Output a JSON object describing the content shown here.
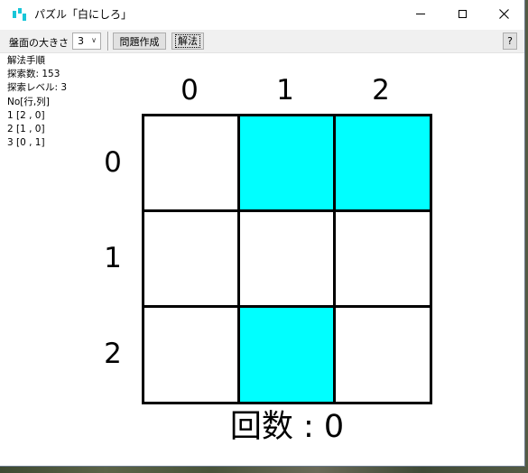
{
  "window": {
    "title": "パズル「白にしろ」"
  },
  "toolbar": {
    "size_label": "盤面の大きさ",
    "size_value": "3",
    "make_button": "問題作成",
    "solve_button": "解法",
    "help_button": "?"
  },
  "solution_log": {
    "heading": "解法手順",
    "search_count": "探索数: 153",
    "search_level": "探索レベル: 3",
    "header": "No[行,列]",
    "steps": [
      "1 [2 , 0]",
      "2 [1 , 0]",
      "3 [0 , 1]"
    ]
  },
  "board": {
    "column_labels": [
      "0",
      "1",
      "2"
    ],
    "row_labels": [
      "0",
      "1",
      "2"
    ],
    "cells": [
      [
        false,
        true,
        true
      ],
      [
        false,
        false,
        false
      ],
      [
        false,
        true,
        false
      ]
    ],
    "on_color": "#00ffff",
    "off_color": "#ffffff"
  },
  "count_label": "回数 : 0"
}
